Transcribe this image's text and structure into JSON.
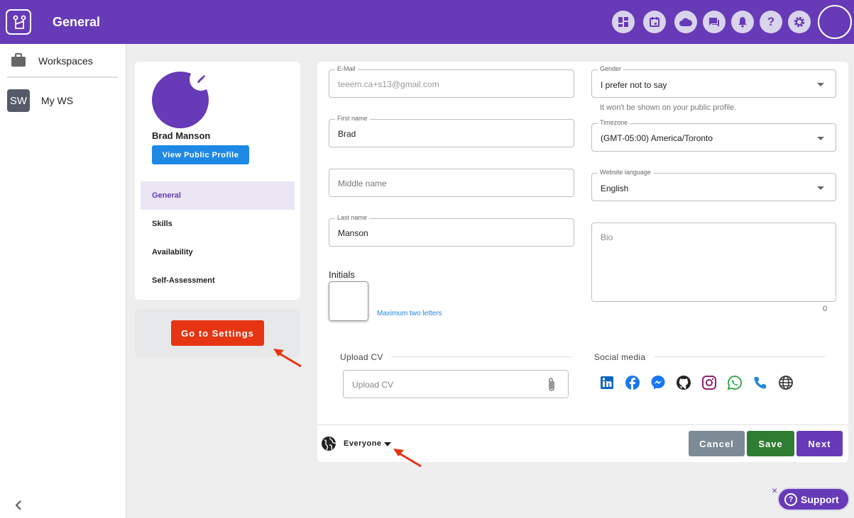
{
  "header": {
    "title": "General",
    "icons": [
      "dashboard-icon",
      "calendar-icon",
      "cloud-icon",
      "chat-icon",
      "bell-icon",
      "help-icon",
      "settings-icon"
    ]
  },
  "sidebar": {
    "workspaces_label": "Workspaces",
    "workspaces": [
      {
        "badge": "SW",
        "name": "My WS"
      }
    ]
  },
  "profile": {
    "name": "Brad Manson",
    "view_public_label": "View Public Profile",
    "menu": [
      {
        "label": "General",
        "active": true
      },
      {
        "label": "Skills",
        "active": false
      },
      {
        "label": "Availability",
        "active": false
      },
      {
        "label": "Self-Assessment",
        "active": false
      }
    ],
    "go_to_settings_label": "Go to Settings"
  },
  "form": {
    "email": {
      "label": "E-Mail",
      "value": "teeem.ca+s13@gmail.com"
    },
    "first_name": {
      "label": "First name",
      "value": "Brad"
    },
    "middle_name": {
      "placeholder": "Middle name"
    },
    "last_name": {
      "label": "Last name",
      "value": "Manson"
    },
    "initials": {
      "label": "Initials",
      "value": "",
      "hint": "Maximum two letters"
    },
    "gender": {
      "label": "Gender",
      "value": "I prefer not to say",
      "hint": "It won't be shown on your public profile."
    },
    "timezone": {
      "label": "Timezone",
      "value": "(GMT-05:00) America/Toronto"
    },
    "language": {
      "label": "Website language",
      "value": "English"
    },
    "bio": {
      "placeholder": "Bio",
      "count": "0"
    },
    "upload_cv": {
      "section_title": "Upload CV",
      "placeholder": "Upload CV"
    },
    "social": {
      "section_title": "Social media",
      "icons": [
        {
          "name": "linkedin-icon",
          "color": "#0a66c2"
        },
        {
          "name": "facebook-icon",
          "color": "#1877f2"
        },
        {
          "name": "messenger-icon",
          "color": "#1877f2"
        },
        {
          "name": "github-icon",
          "color": "#222222"
        },
        {
          "name": "instagram-icon",
          "color": "#8e1f6e"
        },
        {
          "name": "whatsapp-icon",
          "color": "#25a244"
        },
        {
          "name": "phone-icon",
          "color": "#1e88e5"
        },
        {
          "name": "website-icon",
          "color": "#333333"
        }
      ]
    }
  },
  "footer": {
    "audience": "Everyone",
    "cancel_label": "Cancel",
    "save_label": "Save",
    "next_label": "Next"
  },
  "support": {
    "label": "Support",
    "close": "×"
  },
  "colors": {
    "primary": "#673ab7",
    "danger": "#e53512",
    "success": "#2e7d32",
    "info": "#1e88e5",
    "neutral": "#7c8b95"
  }
}
